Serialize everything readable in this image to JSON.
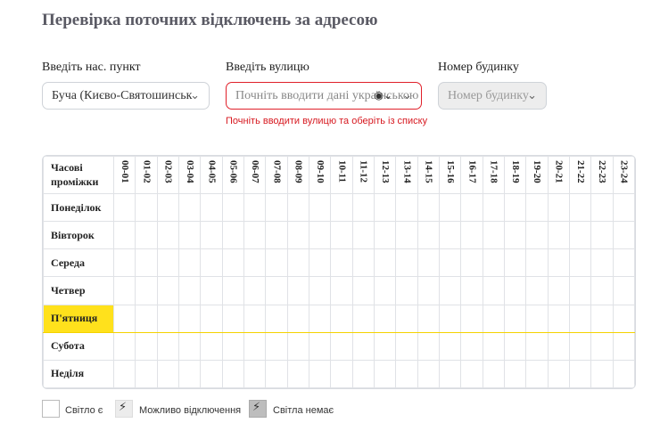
{
  "title": "Перевірка поточних відключень за адресою",
  "fields": {
    "city": {
      "label": "Введіть нас. пункт",
      "value": "Буча (Києво-Святошинськ"
    },
    "street": {
      "label": "Введіть вулицю",
      "placeholder": "Почніть вводити дані українською",
      "error": "Почніть вводити вулицю та оберіть із списку"
    },
    "house": {
      "label": "Номер будинку",
      "placeholder": "Номер будинку"
    }
  },
  "table": {
    "corner_label": "Часові проміжки",
    "hours": [
      "00-01",
      "01-02",
      "02-03",
      "03-04",
      "04-05",
      "05-06",
      "06-07",
      "07-08",
      "08-09",
      "09-10",
      "10-11",
      "11-12",
      "12-13",
      "13-14",
      "14-15",
      "15-16",
      "16-17",
      "17-18",
      "18-19",
      "19-20",
      "20-21",
      "21-22",
      "22-23",
      "23-24"
    ],
    "days": [
      "Понеділок",
      "Вівторок",
      "Середа",
      "Четвер",
      "П'ятниця",
      "Субота",
      "Неділя"
    ],
    "today_index": 4
  },
  "legend": {
    "light_on": "Світло є",
    "maybe_off": "Можливо відключення",
    "no_light": "Світла немає"
  }
}
